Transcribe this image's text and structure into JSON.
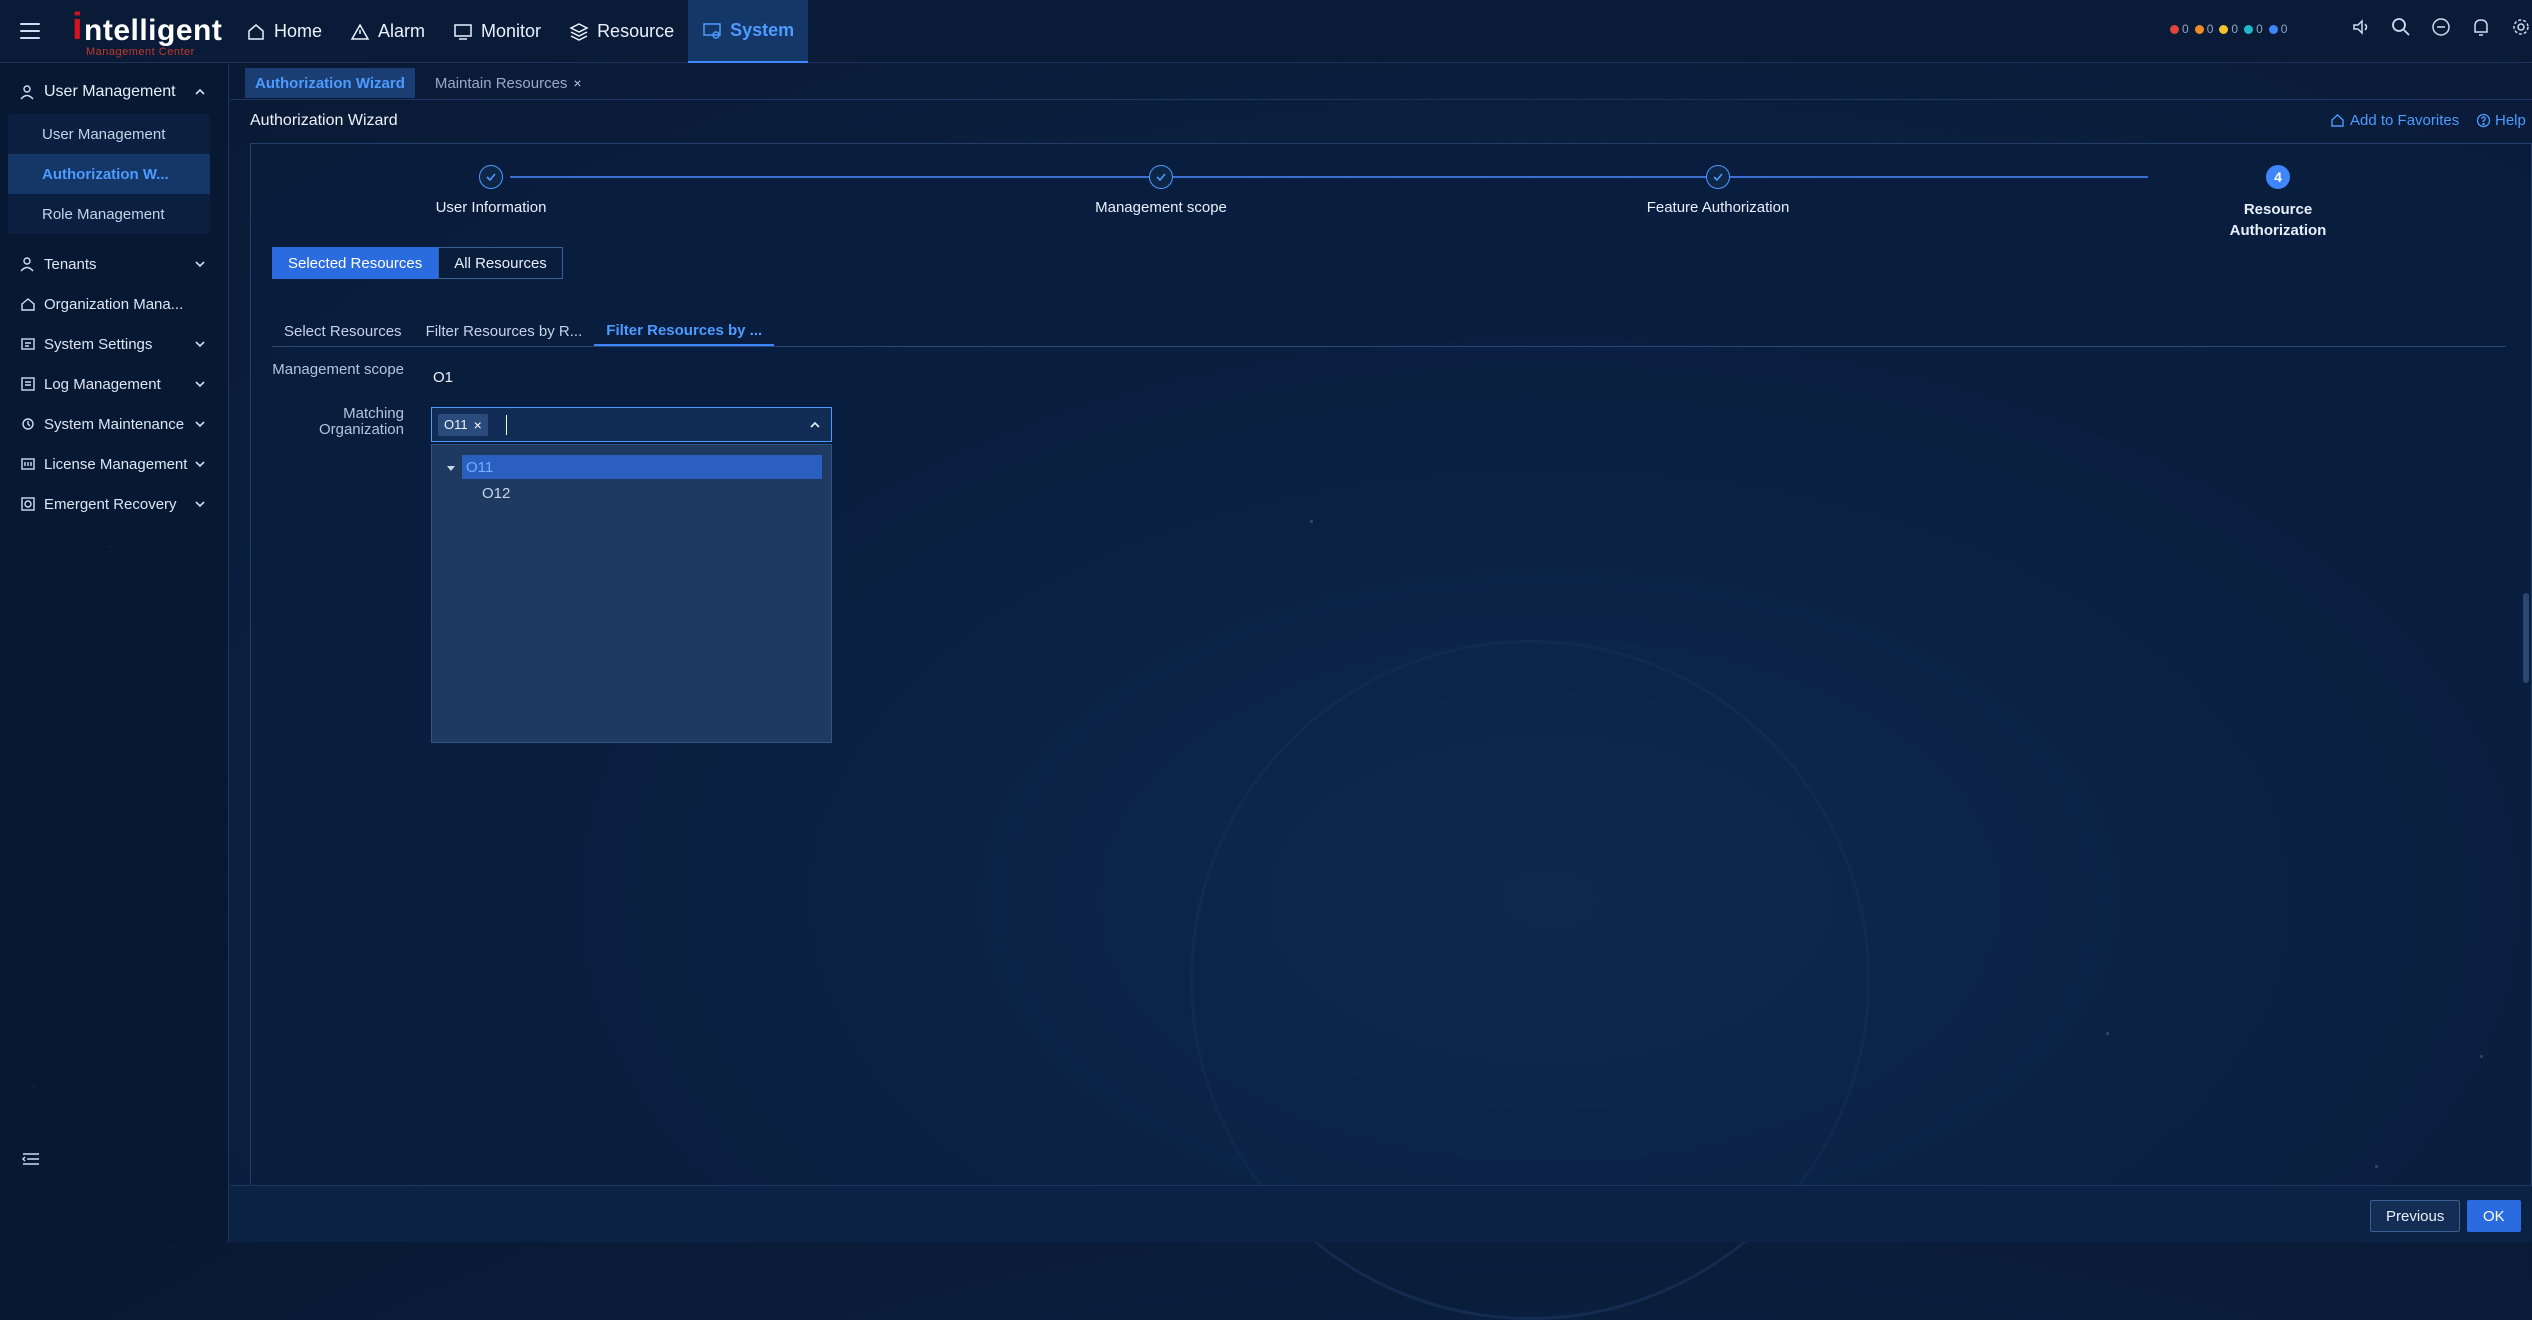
{
  "brand": {
    "logo_i": "i",
    "logo_word": "ntelligent",
    "logo_sub": "Management Center"
  },
  "nav": [
    {
      "label": "Home",
      "icon": "home-icon"
    },
    {
      "label": "Alarm",
      "icon": "alarm-icon"
    },
    {
      "label": "Monitor",
      "icon": "monitor-icon"
    },
    {
      "label": "Resource",
      "icon": "resource-icon"
    },
    {
      "label": "System",
      "icon": "system-icon",
      "active": true
    }
  ],
  "alarms": [
    {
      "count": "0",
      "color": "#e0443c"
    },
    {
      "count": "0",
      "color": "#f08a24"
    },
    {
      "count": "0",
      "color": "#f2c12e"
    },
    {
      "count": "0",
      "color": "#1fb7c9"
    },
    {
      "count": "0",
      "color": "#3d86ff"
    }
  ],
  "sidebar": {
    "head": "User Management",
    "sub": [
      "User Management",
      "Authorization W...",
      "Role Management"
    ],
    "items": [
      {
        "label": "Tenants",
        "chev": true
      },
      {
        "label": "Organization Mana...",
        "chev": false
      },
      {
        "label": "System Settings",
        "chev": true
      },
      {
        "label": "Log Management",
        "chev": true
      },
      {
        "label": "System Maintenance",
        "chev": true
      },
      {
        "label": "License Management",
        "chev": true
      },
      {
        "label": "Emergent Recovery",
        "chev": true
      }
    ]
  },
  "tabs": {
    "active": "Authorization Wizard",
    "other": "Maintain Resources",
    "close": "×"
  },
  "page": {
    "title": "Authorization Wizard",
    "favorites": "Add to Favorites",
    "help": "Help"
  },
  "stepper": {
    "steps": [
      "User Information",
      "Management scope",
      "Feature Authorization",
      "Resource Authorization"
    ],
    "current_number": "4"
  },
  "scope_toggle": {
    "selected": "Selected Resources",
    "all": "All Resources"
  },
  "subtabs": [
    "Select Resources",
    "Filter Resources by R...",
    "Filter Resources by ..."
  ],
  "form": {
    "scope_label": "Management scope",
    "scope_value": "O1",
    "matching_label": "Matching Organization",
    "chip": "O11",
    "chip_close": "×"
  },
  "tree": {
    "parent": "O11",
    "child": "O12"
  },
  "footer": {
    "previous": "Previous",
    "ok": "OK"
  }
}
